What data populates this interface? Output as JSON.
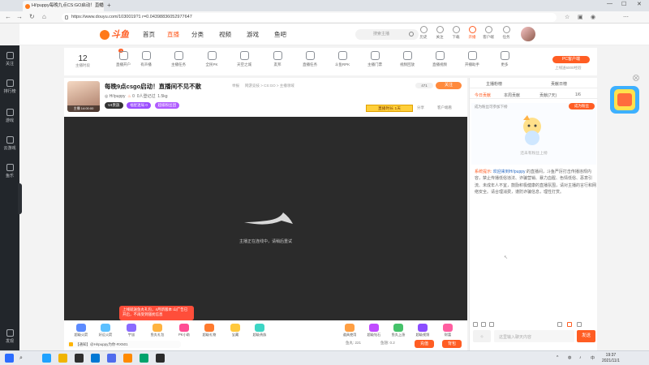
{
  "browser": {
    "tab_title": "Hi!puppy每晚九点CS:GO启动！直播",
    "url": "https://www.douyu.com/1030019?1 r=0.04398836052977647",
    "win_min": "—",
    "win_max": "☐",
    "win_close": "✕"
  },
  "sidebar": {
    "items": [
      {
        "label": "关注"
      },
      {
        "label": "排行榜"
      },
      {
        "label": "游戏"
      },
      {
        "label": "云游戏"
      },
      {
        "label": "鱼乐"
      },
      {
        "label": "发现"
      }
    ]
  },
  "header": {
    "logo": "斗鱼",
    "nav": [
      "首页",
      "直播",
      "分类",
      "视频",
      "游戏",
      "鱼吧"
    ],
    "active_nav": "直播",
    "search_placeholder": "搜索主播",
    "icons": [
      {
        "label": "历史"
      },
      {
        "label": "关注"
      },
      {
        "label": "下载"
      },
      {
        "label": "开播"
      },
      {
        "label": "客户端"
      },
      {
        "label": "任务"
      }
    ]
  },
  "funcbar": {
    "count": "12",
    "count_label": "主播时段",
    "badge": "1",
    "items": [
      {
        "label": "直播开户"
      },
      {
        "label": "有声播"
      },
      {
        "label": "主播任务"
      },
      {
        "label": "全民PK"
      },
      {
        "label": "天空之城"
      },
      {
        "label": "友邦"
      },
      {
        "label": "直播任务"
      },
      {
        "label": "斗鱼RPK"
      },
      {
        "label": "主播门票"
      },
      {
        "label": "视频回放"
      },
      {
        "label": "直播视频"
      },
      {
        "label": "开播助手"
      },
      {
        "label": "更多"
      }
    ],
    "pc_btn": "PC客户端",
    "pc_sub": "上线送6000经验"
  },
  "room": {
    "avatar_label": "主播 14:00:00",
    "title": "每晚9点csgo启动！直播间不见不散",
    "report": "举报",
    "breadcrumb": "网游竞技 > CS:GO > 主播领域",
    "anchor_name": "Hi!puppy",
    "heat": "0",
    "reg": "0人登记过",
    "level": "1.5kg",
    "followers": "471",
    "follow_label": "关注",
    "tags": [
      "V4贵族",
      "福星迷局 0",
      "超级粉丝团"
    ],
    "room_badge": "直播时长 1天",
    "share": "分享",
    "client_watch": "客户端看"
  },
  "player": {
    "loading_text": "主播正在连线中，请稍后重试",
    "notice": "上线就送鱼丸礼包，4月新版本\n山广告已开启，不再受到骚扰信息"
  },
  "giftbar": {
    "gifts": [
      {
        "label": "超级火箭"
      },
      {
        "label": "好运火箭"
      },
      {
        "label": "宇宙"
      },
      {
        "label": "鱼丸礼包"
      },
      {
        "label": "PK小助"
      },
      {
        "label": "超级礼物"
      },
      {
        "label": "宝藏"
      },
      {
        "label": "超级贵族"
      },
      {
        "label": "道具使用"
      },
      {
        "label": "超级钻石"
      },
      {
        "label": "鱼丸上涨"
      },
      {
        "label": "超级视频"
      },
      {
        "label": "财富"
      }
    ],
    "broadcast": "【通知】@Hi!puppy为你-RX501",
    "wallet_fish": "鱼丸: 221",
    "wallet_yuchi": "鱼翅: 0.2",
    "recharge": "充值",
    "backpack": "背包"
  },
  "right_panel": {
    "head_left": "主播粉榜",
    "head_right": "贡献日榜",
    "tabs": [
      "今日贡献",
      "本周贡献",
      "贡献(7天)",
      "1/6"
    ],
    "empty_hint": "成为粉丝可参加下榜",
    "join_btn": "成为粉丝",
    "empty_cta": "还未有粉丝上榜",
    "sys_label": "系统提示:",
    "sys_name": "欢迎来到Hi!puppy",
    "sys_text": "的直播间，斗鱼严厉打击传播违规内容，禁止传播低俗违法、诈骗营销、暴力血腥、色情低俗、恶意引流、未成年人不宜，鼓励积极健康的直播氛围，请对主播的言行和网络安全。请合理消费，谨防诈骗信息，理性打赏。",
    "chat_placeholder": "这里输入聊天内容",
    "send_label": "发送"
  },
  "taskbar": {
    "time": "19:37",
    "date": "2021/11/1",
    "lang": "中"
  }
}
